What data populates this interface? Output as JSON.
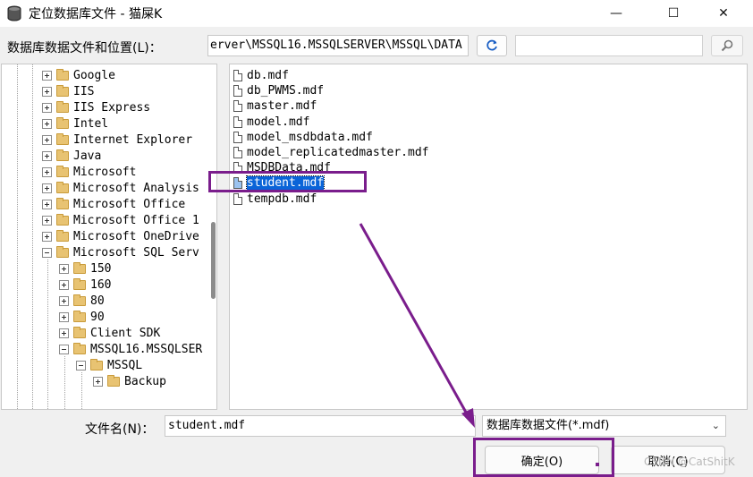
{
  "window": {
    "title": "定位数据库文件 - 猫屎K",
    "minimize_glyph": "—",
    "maximize_glyph": "☐",
    "close_glyph": "✕"
  },
  "location": {
    "label": "数据库数据文件和位置(L)：",
    "path_visible": "erver\\MSSQL16.MSSQLSERVER\\MSSQL\\DATA"
  },
  "icons": {
    "refresh": "refresh-icon",
    "search": "search-icon",
    "folder": "folder-icon",
    "file": "file-icon"
  },
  "tree": {
    "items": [
      {
        "label": "Google",
        "level": 0,
        "state": "closed"
      },
      {
        "label": "IIS",
        "level": 0,
        "state": "closed"
      },
      {
        "label": "IIS Express",
        "level": 0,
        "state": "closed"
      },
      {
        "label": "Intel",
        "level": 0,
        "state": "closed"
      },
      {
        "label": "Internet Explorer",
        "level": 0,
        "state": "closed"
      },
      {
        "label": "Java",
        "level": 0,
        "state": "closed"
      },
      {
        "label": "Microsoft",
        "level": 0,
        "state": "closed"
      },
      {
        "label": "Microsoft Analysis",
        "level": 0,
        "state": "closed"
      },
      {
        "label": "Microsoft Office",
        "level": 0,
        "state": "closed"
      },
      {
        "label": "Microsoft Office 1",
        "level": 0,
        "state": "closed"
      },
      {
        "label": "Microsoft OneDrive",
        "level": 0,
        "state": "closed"
      },
      {
        "label": "Microsoft SQL Serv",
        "level": 0,
        "state": "open"
      },
      {
        "label": "150",
        "level": 1,
        "state": "closed"
      },
      {
        "label": "160",
        "level": 1,
        "state": "closed"
      },
      {
        "label": "80",
        "level": 1,
        "state": "closed"
      },
      {
        "label": "90",
        "level": 1,
        "state": "closed"
      },
      {
        "label": "Client SDK",
        "level": 1,
        "state": "closed"
      },
      {
        "label": "MSSQL16.MSSQLSER",
        "level": 1,
        "state": "open"
      },
      {
        "label": "MSSQL",
        "level": 2,
        "state": "open"
      },
      {
        "label": "Backup",
        "level": 3,
        "state": "closed"
      }
    ]
  },
  "files": {
    "items": [
      {
        "name": "db.mdf",
        "selected": false
      },
      {
        "name": "db_PWMS.mdf",
        "selected": false
      },
      {
        "name": "master.mdf",
        "selected": false
      },
      {
        "name": "model.mdf",
        "selected": false
      },
      {
        "name": "model_msdbdata.mdf",
        "selected": false
      },
      {
        "name": "model_replicatedmaster.mdf",
        "selected": false
      },
      {
        "name": "MSDBData.mdf",
        "selected": false
      },
      {
        "name": "student.mdf",
        "selected": true
      },
      {
        "name": "tempdb.mdf",
        "selected": false
      }
    ]
  },
  "filename": {
    "label": "文件名(N)：",
    "value": "student.mdf"
  },
  "filetype": {
    "selected": "数据库数据文件(*.mdf)"
  },
  "buttons": {
    "ok": "确定(O)",
    "cancel": "取消(C)"
  },
  "watermark": "CSDN @CatShitK",
  "colors": {
    "annotation": "#7a1d8c",
    "selection": "#0a64d8"
  }
}
